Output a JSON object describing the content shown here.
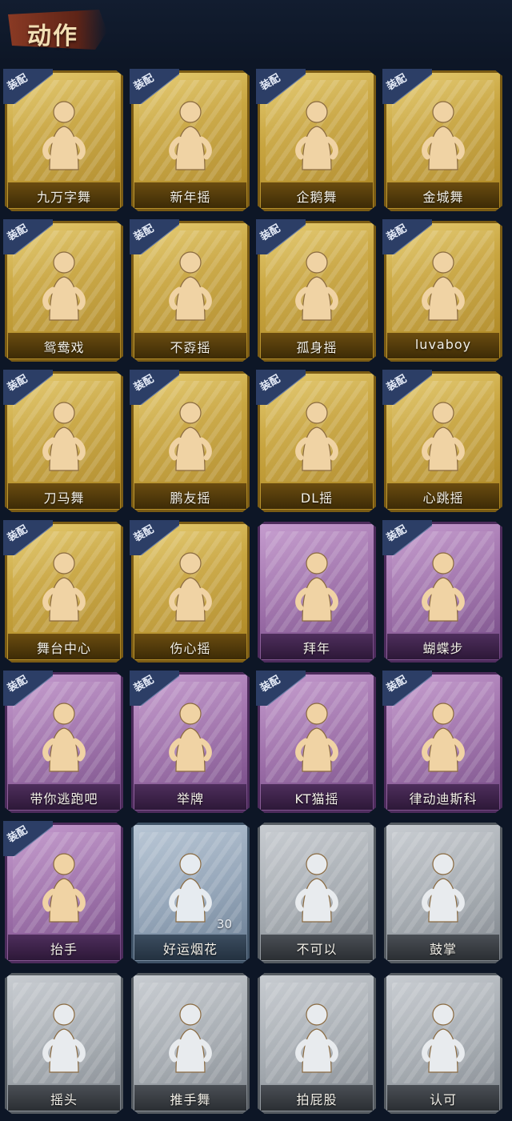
{
  "header": {
    "title": "动作"
  },
  "equip_label": "装配",
  "cards": [
    {
      "label": "九万字舞",
      "style": "gold",
      "equipped": true
    },
    {
      "label": "新年摇",
      "style": "gold",
      "equipped": true
    },
    {
      "label": "企鹅舞",
      "style": "gold",
      "equipped": true
    },
    {
      "label": "金城舞",
      "style": "gold",
      "equipped": true
    },
    {
      "label": "鸳鸯戏",
      "style": "gold",
      "equipped": true
    },
    {
      "label": "不孬摇",
      "style": "gold",
      "equipped": true
    },
    {
      "label": "孤身摇",
      "style": "gold",
      "equipped": true
    },
    {
      "label": "luvaboy",
      "style": "gold",
      "equipped": true
    },
    {
      "label": "刀马舞",
      "style": "gold",
      "equipped": true
    },
    {
      "label": "鹏友摇",
      "style": "gold",
      "equipped": true
    },
    {
      "label": "DL摇",
      "style": "gold",
      "equipped": true
    },
    {
      "label": "心跳摇",
      "style": "gold",
      "equipped": true
    },
    {
      "label": "舞台中心",
      "style": "gold",
      "equipped": true
    },
    {
      "label": "伤心摇",
      "style": "gold",
      "equipped": true
    },
    {
      "label": "拜年",
      "style": "purple",
      "equipped": false
    },
    {
      "label": "蝴蝶步",
      "style": "purple",
      "equipped": true
    },
    {
      "label": "带你逃跑吧",
      "style": "purple",
      "equipped": true
    },
    {
      "label": "举牌",
      "style": "purple",
      "equipped": true
    },
    {
      "label": "KT猫摇",
      "style": "purple",
      "equipped": true
    },
    {
      "label": "律动迪斯科",
      "style": "purple",
      "equipped": true
    },
    {
      "label": "抬手",
      "style": "purple",
      "equipped": true
    },
    {
      "label": "好运烟花",
      "style": "blue",
      "equipped": false,
      "count": "30"
    },
    {
      "label": "不可以",
      "style": "grey",
      "equipped": false
    },
    {
      "label": "鼓掌",
      "style": "grey",
      "equipped": false
    },
    {
      "label": "摇头",
      "style": "grey",
      "equipped": false
    },
    {
      "label": "推手舞",
      "style": "grey",
      "equipped": false
    },
    {
      "label": "拍屁股",
      "style": "grey",
      "equipped": false
    },
    {
      "label": "认可",
      "style": "grey",
      "equipped": false
    }
  ],
  "colors": {
    "background": "#0d1626",
    "gold": "#c9a641",
    "purple": "#9d6fa9",
    "blue": "#8ea0b4",
    "grey": "#a2a8ae",
    "equip_tag": "#2c3e66"
  }
}
